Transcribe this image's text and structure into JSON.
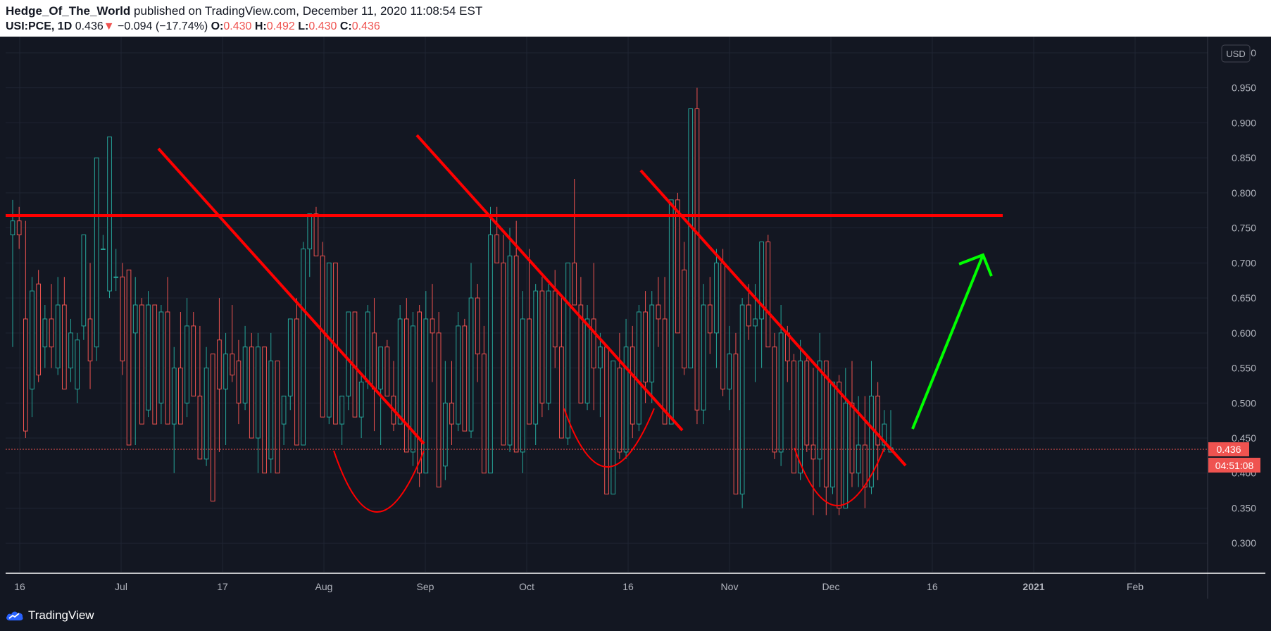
{
  "header": {
    "author": "Hedge_Of_The_World",
    "published": "published on TradingView.com, December 11, 2020 11:08:54 EST",
    "symbol": "USI:PCE, 1D",
    "last": "0.436",
    "change": "−0.094 (−17.74%)",
    "o_label": "O:",
    "o_value": "0.430",
    "h_label": "H:",
    "h_value": "0.492",
    "l_label": "L:",
    "l_value": "0.430",
    "c_label": "C:",
    "c_value": "0.436"
  },
  "brand": {
    "name": "TradingView"
  },
  "colors": {
    "background": "#131722",
    "up": "#26a69a",
    "down": "#ef5350",
    "drawing_red": "#ff0000",
    "drawing_green": "#00ff00",
    "axis_text": "#b2b5be"
  },
  "chart_data": {
    "type": "candlestick",
    "currency": "USD",
    "ylim": [
      0.26,
      1.01
    ],
    "y_ticks": [
      "1.000",
      "0.950",
      "0.900",
      "0.850",
      "0.800",
      "0.750",
      "0.700",
      "0.650",
      "0.600",
      "0.550",
      "0.500",
      "0.450",
      "0.400",
      "0.350",
      "0.300"
    ],
    "x_ticks": [
      "16",
      "Jul",
      "17",
      "Aug",
      "Sep",
      "Oct",
      "16",
      "Nov",
      "Dec",
      "16",
      "2021",
      "Feb"
    ],
    "x_ticks_bold": [
      "2021"
    ],
    "last_price": "0.436",
    "countdown": "04:51:08",
    "candles_ohlc": [
      [
        0.74,
        0.79,
        0.58,
        0.76
      ],
      [
        0.76,
        0.78,
        0.72,
        0.74
      ],
      [
        0.62,
        0.76,
        0.45,
        0.46
      ],
      [
        0.52,
        0.68,
        0.48,
        0.66
      ],
      [
        0.67,
        0.69,
        0.53,
        0.54
      ],
      [
        0.58,
        0.64,
        0.55,
        0.62
      ],
      [
        0.62,
        0.67,
        0.55,
        0.58
      ],
      [
        0.55,
        0.68,
        0.54,
        0.64
      ],
      [
        0.64,
        0.68,
        0.52,
        0.52
      ],
      [
        0.55,
        0.62,
        0.53,
        0.6
      ],
      [
        0.52,
        0.6,
        0.5,
        0.59
      ],
      [
        0.61,
        0.74,
        0.59,
        0.74
      ],
      [
        0.62,
        0.7,
        0.52,
        0.56
      ],
      [
        0.58,
        0.85,
        0.56,
        0.85
      ],
      [
        0.72,
        0.74,
        0.72,
        0.72
      ],
      [
        0.66,
        0.88,
        0.65,
        0.88
      ],
      [
        0.68,
        0.72,
        0.66,
        0.68
      ],
      [
        0.68,
        0.7,
        0.54,
        0.56
      ],
      [
        0.69,
        0.69,
        0.44,
        0.44
      ],
      [
        0.6,
        0.68,
        0.44,
        0.64
      ],
      [
        0.64,
        0.65,
        0.47,
        0.47
      ],
      [
        0.49,
        0.66,
        0.48,
        0.64
      ],
      [
        0.64,
        0.64,
        0.47,
        0.47
      ],
      [
        0.5,
        0.64,
        0.47,
        0.63
      ],
      [
        0.63,
        0.68,
        0.47,
        0.47
      ],
      [
        0.47,
        0.58,
        0.4,
        0.55
      ],
      [
        0.55,
        0.63,
        0.47,
        0.47
      ],
      [
        0.5,
        0.65,
        0.48,
        0.61
      ],
      [
        0.61,
        0.63,
        0.51,
        0.51
      ],
      [
        0.51,
        0.61,
        0.42,
        0.42
      ],
      [
        0.42,
        0.58,
        0.41,
        0.55
      ],
      [
        0.57,
        0.57,
        0.36,
        0.36
      ],
      [
        0.59,
        0.65,
        0.43,
        0.52
      ],
      [
        0.52,
        0.6,
        0.44,
        0.57
      ],
      [
        0.57,
        0.64,
        0.53,
        0.54
      ],
      [
        0.56,
        0.59,
        0.47,
        0.5
      ],
      [
        0.5,
        0.61,
        0.49,
        0.58
      ],
      [
        0.58,
        0.6,
        0.45,
        0.45
      ],
      [
        0.45,
        0.6,
        0.4,
        0.58
      ],
      [
        0.58,
        0.58,
        0.4,
        0.4
      ],
      [
        0.42,
        0.6,
        0.4,
        0.56
      ],
      [
        0.56,
        0.56,
        0.4,
        0.4
      ],
      [
        0.47,
        0.51,
        0.44,
        0.51
      ],
      [
        0.51,
        0.62,
        0.49,
        0.62
      ],
      [
        0.62,
        0.65,
        0.44,
        0.44
      ],
      [
        0.44,
        0.73,
        0.44,
        0.72
      ],
      [
        0.72,
        0.77,
        0.68,
        0.77
      ],
      [
        0.77,
        0.78,
        0.71,
        0.71
      ],
      [
        0.71,
        0.73,
        0.48,
        0.48
      ],
      [
        0.48,
        0.7,
        0.47,
        0.7
      ],
      [
        0.7,
        0.7,
        0.47,
        0.47
      ],
      [
        0.47,
        0.51,
        0.44,
        0.51
      ],
      [
        0.51,
        0.63,
        0.49,
        0.63
      ],
      [
        0.63,
        0.63,
        0.48,
        0.48
      ],
      [
        0.48,
        0.54,
        0.45,
        0.53
      ],
      [
        0.53,
        0.64,
        0.52,
        0.63
      ],
      [
        0.6,
        0.65,
        0.46,
        0.52
      ],
      [
        0.52,
        0.58,
        0.44,
        0.58
      ],
      [
        0.58,
        0.59,
        0.51,
        0.51
      ],
      [
        0.51,
        0.56,
        0.46,
        0.47
      ],
      [
        0.47,
        0.64,
        0.47,
        0.62
      ],
      [
        0.62,
        0.65,
        0.43,
        0.43
      ],
      [
        0.43,
        0.63,
        0.41,
        0.61
      ],
      [
        0.63,
        0.64,
        0.38,
        0.4
      ],
      [
        0.4,
        0.66,
        0.4,
        0.62
      ],
      [
        0.62,
        0.67,
        0.53,
        0.6
      ],
      [
        0.6,
        0.63,
        0.38,
        0.38
      ],
      [
        0.41,
        0.56,
        0.39,
        0.5
      ],
      [
        0.5,
        0.56,
        0.44,
        0.47
      ],
      [
        0.47,
        0.63,
        0.46,
        0.61
      ],
      [
        0.61,
        0.62,
        0.46,
        0.46
      ],
      [
        0.46,
        0.7,
        0.45,
        0.65
      ],
      [
        0.65,
        0.67,
        0.53,
        0.57
      ],
      [
        0.57,
        0.61,
        0.4,
        0.4
      ],
      [
        0.4,
        0.78,
        0.4,
        0.74
      ],
      [
        0.74,
        0.78,
        0.7,
        0.7
      ],
      [
        0.7,
        0.74,
        0.44,
        0.44
      ],
      [
        0.44,
        0.75,
        0.43,
        0.71
      ],
      [
        0.71,
        0.76,
        0.43,
        0.43
      ],
      [
        0.43,
        0.66,
        0.4,
        0.62
      ],
      [
        0.62,
        0.72,
        0.47,
        0.47
      ],
      [
        0.47,
        0.67,
        0.44,
        0.66
      ],
      [
        0.66,
        0.68,
        0.48,
        0.5
      ],
      [
        0.5,
        0.67,
        0.49,
        0.66
      ],
      [
        0.66,
        0.69,
        0.55,
        0.58
      ],
      [
        0.58,
        0.65,
        0.45,
        0.45
      ],
      [
        0.45,
        0.7,
        0.44,
        0.7
      ],
      [
        0.7,
        0.82,
        0.64,
        0.64
      ],
      [
        0.64,
        0.68,
        0.5,
        0.5
      ],
      [
        0.5,
        0.64,
        0.49,
        0.62
      ],
      [
        0.62,
        0.7,
        0.49,
        0.55
      ],
      [
        0.55,
        0.6,
        0.48,
        0.58
      ],
      [
        0.58,
        0.58,
        0.37,
        0.37
      ],
      [
        0.37,
        0.56,
        0.37,
        0.56
      ],
      [
        0.55,
        0.6,
        0.42,
        0.43
      ],
      [
        0.43,
        0.62,
        0.42,
        0.58
      ],
      [
        0.58,
        0.61,
        0.45,
        0.47
      ],
      [
        0.47,
        0.64,
        0.46,
        0.63
      ],
      [
        0.63,
        0.66,
        0.5,
        0.53
      ],
      [
        0.53,
        0.66,
        0.5,
        0.64
      ],
      [
        0.64,
        0.68,
        0.58,
        0.62
      ],
      [
        0.62,
        0.68,
        0.47,
        0.47
      ],
      [
        0.47,
        0.79,
        0.47,
        0.79
      ],
      [
        0.79,
        0.8,
        0.6,
        0.6
      ],
      [
        0.69,
        0.73,
        0.54,
        0.55
      ],
      [
        0.55,
        0.92,
        0.55,
        0.92
      ],
      [
        0.92,
        0.95,
        0.47,
        0.49
      ],
      [
        0.49,
        0.67,
        0.47,
        0.64
      ],
      [
        0.64,
        0.68,
        0.57,
        0.6
      ],
      [
        0.6,
        0.72,
        0.55,
        0.7
      ],
      [
        0.7,
        0.72,
        0.51,
        0.52
      ],
      [
        0.52,
        0.61,
        0.49,
        0.57
      ],
      [
        0.57,
        0.6,
        0.37,
        0.37
      ],
      [
        0.37,
        0.65,
        0.35,
        0.64
      ],
      [
        0.64,
        0.67,
        0.59,
        0.61
      ],
      [
        0.61,
        0.67,
        0.53,
        0.62
      ],
      [
        0.62,
        0.73,
        0.55,
        0.73
      ],
      [
        0.73,
        0.74,
        0.58,
        0.58
      ],
      [
        0.58,
        0.6,
        0.42,
        0.43
      ],
      [
        0.43,
        0.64,
        0.41,
        0.6
      ],
      [
        0.6,
        0.61,
        0.53,
        0.56
      ],
      [
        0.56,
        0.57,
        0.4,
        0.4
      ],
      [
        0.4,
        0.59,
        0.39,
        0.56
      ],
      [
        0.56,
        0.57,
        0.43,
        0.44
      ],
      [
        0.44,
        0.55,
        0.34,
        0.42
      ],
      [
        0.42,
        0.6,
        0.38,
        0.56
      ],
      [
        0.56,
        0.56,
        0.34,
        0.38
      ],
      [
        0.38,
        0.53,
        0.37,
        0.53
      ],
      [
        0.53,
        0.54,
        0.34,
        0.35
      ],
      [
        0.35,
        0.55,
        0.35,
        0.5
      ],
      [
        0.5,
        0.56,
        0.38,
        0.4
      ],
      [
        0.4,
        0.51,
        0.38,
        0.44
      ],
      [
        0.44,
        0.51,
        0.35,
        0.38
      ],
      [
        0.38,
        0.56,
        0.37,
        0.51
      ],
      [
        0.51,
        0.53,
        0.39,
        0.44
      ],
      [
        0.44,
        0.49,
        0.43,
        0.47
      ],
      [
        0.43,
        0.49,
        0.43,
        0.436
      ]
    ]
  }
}
